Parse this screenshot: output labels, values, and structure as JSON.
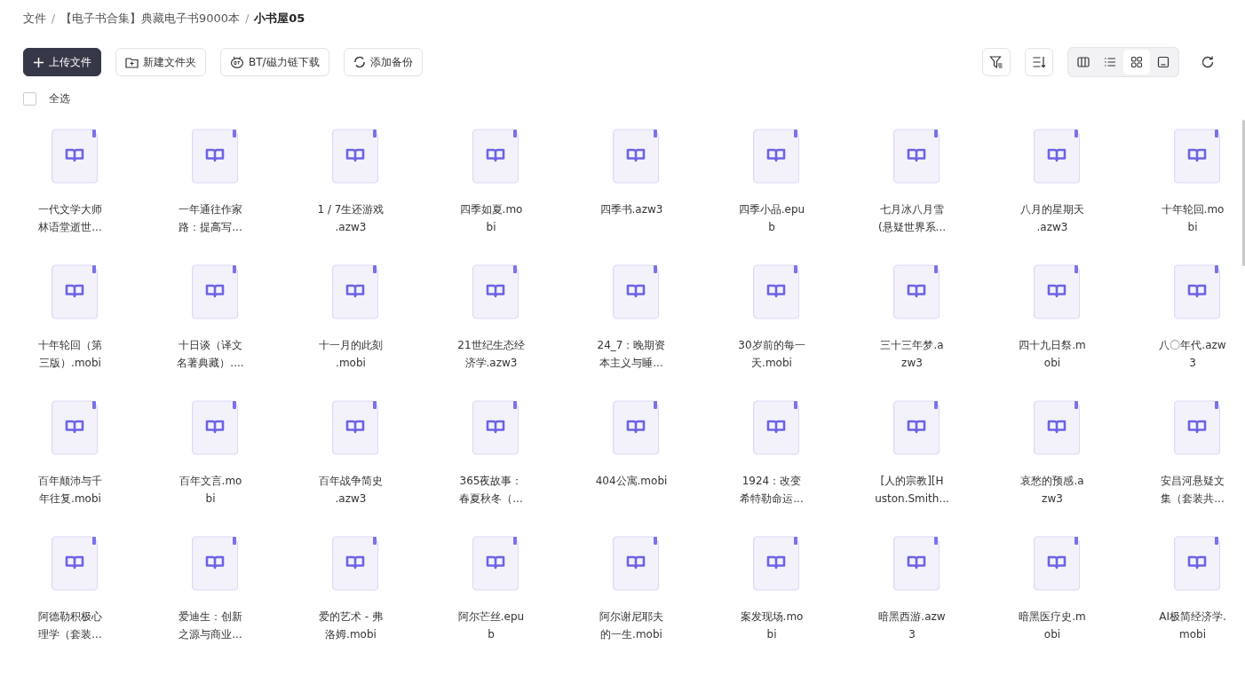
{
  "breadcrumb": [
    {
      "label": "文件",
      "current": false
    },
    {
      "label": "【电子书合集】典藏电子书9000本",
      "current": false
    },
    {
      "label": "小书屋05",
      "current": true
    }
  ],
  "separator": "/",
  "toolbar": [
    {
      "kind": "upload",
      "label": "上传文件"
    },
    {
      "kind": "folder",
      "label": "新建文件夹"
    },
    {
      "kind": "torrent",
      "label": "BT/磁力链下载"
    },
    {
      "kind": "backup",
      "label": "添加备份"
    }
  ],
  "view_modes": [
    {
      "selected": false
    },
    {
      "selected": false
    },
    {
      "selected": true
    },
    {
      "selected": false
    }
  ],
  "select_all": {
    "label": "全选",
    "checked": false
  },
  "files": [
    {
      "lines": [
        "一代文学大师",
        "林语堂逝世..."
      ]
    },
    {
      "lines": [
        "一年通往作家",
        "路：提高写..."
      ]
    },
    {
      "lines": [
        "1 / 7生还游戏",
        ".azw3"
      ]
    },
    {
      "lines": [
        "四季如夏.mo",
        "bi"
      ]
    },
    {
      "lines": [
        "四季书.azw3"
      ]
    },
    {
      "lines": [
        "四季小品.epu",
        "b"
      ]
    },
    {
      "lines": [
        "七月冰八月雪",
        "(悬疑世界系..."
      ]
    },
    {
      "lines": [
        "八月的星期天",
        ".azw3"
      ]
    },
    {
      "lines": [
        "十年轮回.mo",
        "bi"
      ]
    },
    {
      "lines": [
        "十年轮回（第",
        "三版）.mobi"
      ]
    },
    {
      "lines": [
        "十日谈（译文",
        "名著典藏）...."
      ]
    },
    {
      "lines": [
        "十一月的此刻",
        ".mobi"
      ]
    },
    {
      "lines": [
        "21世纪生态经",
        "济学.azw3"
      ]
    },
    {
      "lines": [
        "24_7：晚期资",
        "本主义与睡..."
      ]
    },
    {
      "lines": [
        "30岁前的每一",
        "天.mobi"
      ]
    },
    {
      "lines": [
        "三十三年梦.a",
        "zw3"
      ]
    },
    {
      "lines": [
        "四十九日祭.m",
        "obi"
      ]
    },
    {
      "lines": [
        "八〇年代.azw",
        "3"
      ]
    },
    {
      "lines": [
        "百年颠沛与千",
        "年往复.mobi"
      ]
    },
    {
      "lines": [
        "百年文言.mo",
        "bi"
      ]
    },
    {
      "lines": [
        "百年战争简史",
        ".azw3"
      ]
    },
    {
      "lines": [
        "365夜故事：",
        "春夏秋冬（..."
      ]
    },
    {
      "lines": [
        "404公寓.mobi"
      ]
    },
    {
      "lines": [
        "1924：改变",
        "希特勒命运..."
      ]
    },
    {
      "lines": [
        "[人的宗教][H",
        "uston.Smith..."
      ]
    },
    {
      "lines": [
        "哀愁的预感.a",
        "zw3"
      ]
    },
    {
      "lines": [
        "安昌河悬疑文",
        "集（套装共..."
      ]
    },
    {
      "lines": [
        "阿德勒积极心",
        "理学（套装..."
      ]
    },
    {
      "lines": [
        "爱迪生：创新",
        "之源与商业..."
      ]
    },
    {
      "lines": [
        "爱的艺术 - 弗",
        "洛姆.mobi"
      ]
    },
    {
      "lines": [
        "阿尔芒丝.epu",
        "b"
      ]
    },
    {
      "lines": [
        "阿尔谢尼耶夫",
        "的一生.mobi"
      ]
    },
    {
      "lines": [
        "案发现场.mo",
        "bi"
      ]
    },
    {
      "lines": [
        "暗黑西游.azw",
        "3"
      ]
    },
    {
      "lines": [
        "暗黑医疗史.m",
        "obi"
      ]
    },
    {
      "lines": [
        "AI极简经济学.",
        "mobi"
      ]
    }
  ]
}
